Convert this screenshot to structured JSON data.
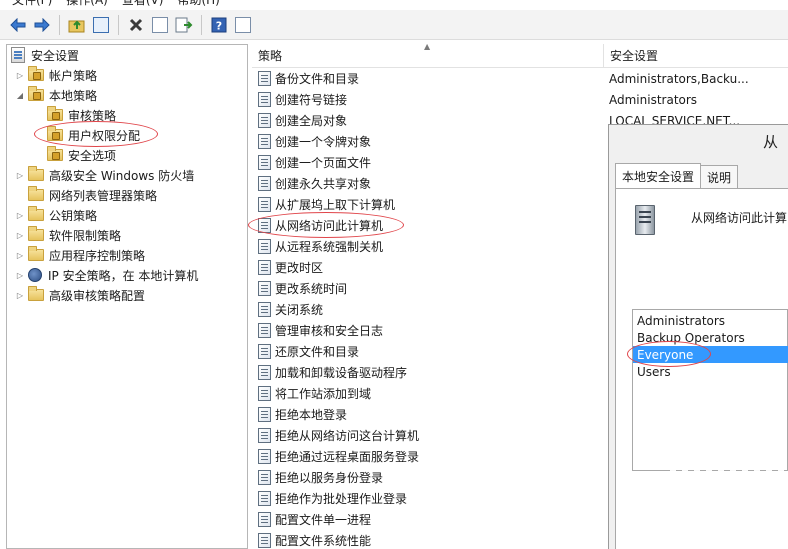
{
  "menubar": {
    "items": [
      "文件(F)",
      "操作(A)",
      "查看(V)",
      "帮助(H)"
    ]
  },
  "toolbar": {
    "icons": [
      "back-icon",
      "forward-icon",
      "up-folder-icon",
      "show-tree-icon",
      "delete-icon",
      "properties-icon",
      "export-icon",
      "help-icon",
      "view-icon"
    ]
  },
  "tree": {
    "root": "安全设置",
    "items": [
      {
        "label": "帐户策略"
      },
      {
        "label": "本地策略"
      },
      {
        "label": "审核策略"
      },
      {
        "label": "用户权限分配"
      },
      {
        "label": "安全选项"
      },
      {
        "label": "高级安全 Windows 防火墙"
      },
      {
        "label": "网络列表管理器策略"
      },
      {
        "label": "公钥策略"
      },
      {
        "label": "软件限制策略"
      },
      {
        "label": "应用程序控制策略"
      },
      {
        "label": "IP 安全策略，在 本地计算机"
      },
      {
        "label": "高级审核策略配置"
      }
    ]
  },
  "list": {
    "header_policy": "策略",
    "header_setting": "安全设置",
    "rows": [
      {
        "policy": "备份文件和目录",
        "setting": "Administrators,Backu..."
      },
      {
        "policy": "创建符号链接",
        "setting": "Administrators"
      },
      {
        "policy": "创建全局对象",
        "setting": "LOCAL SERVICE,NET..."
      },
      {
        "policy": "创建一个令牌对象",
        "setting": ""
      },
      {
        "policy": "创建一个页面文件",
        "setting": ""
      },
      {
        "policy": "创建永久共享对象",
        "setting": ""
      },
      {
        "policy": "从扩展坞上取下计算机",
        "setting": ""
      },
      {
        "policy": "从网络访问此计算机",
        "setting": ""
      },
      {
        "policy": "从远程系统强制关机",
        "setting": ""
      },
      {
        "policy": "更改时区",
        "setting": ""
      },
      {
        "policy": "更改系统时间",
        "setting": ""
      },
      {
        "policy": "关闭系统",
        "setting": ""
      },
      {
        "policy": "管理审核和安全日志",
        "setting": ""
      },
      {
        "policy": "还原文件和目录",
        "setting": ""
      },
      {
        "policy": "加载和卸载设备驱动程序",
        "setting": ""
      },
      {
        "policy": "将工作站添加到域",
        "setting": ""
      },
      {
        "policy": "拒绝本地登录",
        "setting": ""
      },
      {
        "policy": "拒绝从网络访问这台计算机",
        "setting": ""
      },
      {
        "policy": "拒绝通过远程桌面服务登录",
        "setting": ""
      },
      {
        "policy": "拒绝以服务身份登录",
        "setting": ""
      },
      {
        "policy": "拒绝作为批处理作业登录",
        "setting": ""
      },
      {
        "policy": "配置文件单一进程",
        "setting": ""
      },
      {
        "policy": "配置文件系统性能",
        "setting": ""
      }
    ]
  },
  "dialog": {
    "title": "从",
    "tabs": [
      "本地安全设置",
      "说明"
    ],
    "policy_name": "从网络访问此计算",
    "users": [
      "Administrators",
      "Backup Operators",
      "Everyone",
      "Users"
    ],
    "selected_user": "Everyone"
  },
  "colors": {
    "annotation": "#e0454a",
    "selection": "#3399ff"
  }
}
